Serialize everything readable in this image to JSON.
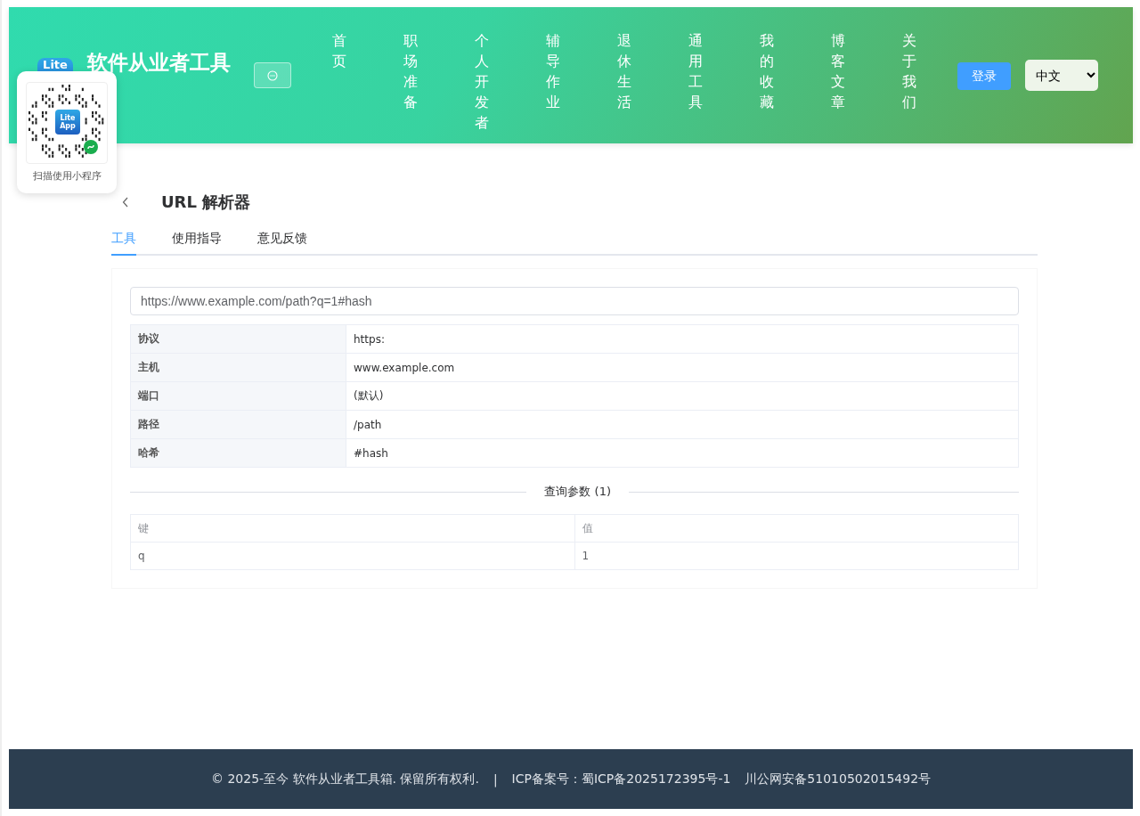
{
  "header": {
    "logo_text": "Lite",
    "title": "软件从业者工具",
    "nav": [
      {
        "label": "首页"
      },
      {
        "label": "职场准备"
      },
      {
        "label": "个人开发者"
      },
      {
        "label": "辅导作业"
      },
      {
        "label": "退休生活"
      },
      {
        "label": "通用工具"
      },
      {
        "label": "我的收藏"
      },
      {
        "label": "博客文章"
      },
      {
        "label": "关于我们"
      }
    ],
    "login_button": "登录",
    "language": "中文"
  },
  "mini_program_popup": {
    "logo_lines": [
      "Lite",
      "App"
    ],
    "caption": "扫描使用小程序"
  },
  "page": {
    "title": "URL 解析器",
    "tabs": [
      {
        "label": "工具",
        "selected": true
      },
      {
        "label": "使用指导",
        "selected": false
      },
      {
        "label": "意见反馈",
        "selected": false
      }
    ],
    "url_input": {
      "value": "https://www.example.com/path?q=1#hash"
    },
    "parts": [
      {
        "label": "协议",
        "value": "https:"
      },
      {
        "label": "主机",
        "value": "www.example.com"
      },
      {
        "label": "端口",
        "value": "(默认)"
      },
      {
        "label": "路径",
        "value": "/path"
      },
      {
        "label": "哈希",
        "value": "#hash"
      }
    ],
    "query_divider": "查询参数 (1)",
    "query_table": {
      "columns": [
        "键",
        "值"
      ],
      "rows": [
        [
          "q",
          "1"
        ]
      ]
    }
  },
  "footer": {
    "copyright": "© 2025-至今 软件从业者工具箱. 保留所有权利.",
    "separator": "|",
    "icp": "ICP备案号：蜀ICP备2025172395号-1",
    "police": "川公网安备51010502015492号"
  }
}
